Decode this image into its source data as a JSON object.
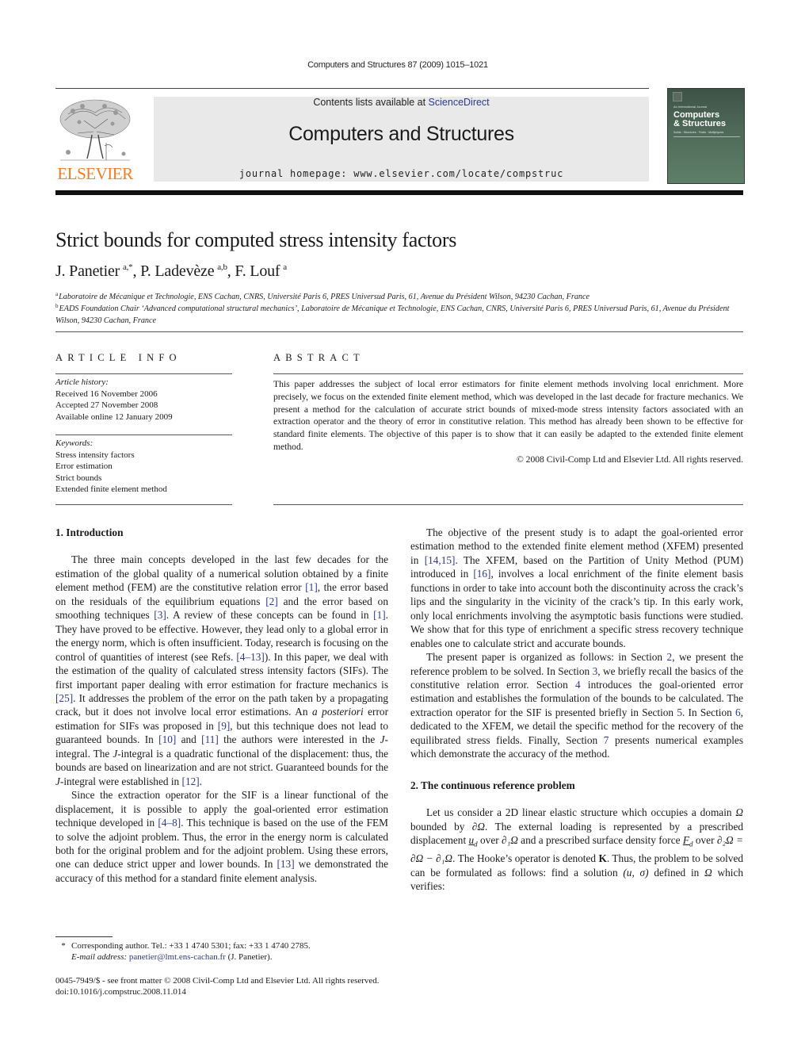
{
  "header": {
    "citation": "Computers and Structures 87 (2009) 1015–1021",
    "contents_prefix": "Contents lists available at ",
    "contents_link": "ScienceDirect",
    "journal_name": "Computers and Structures",
    "homepage": "journal homepage: www.elsevier.com/locate/compstruc",
    "publisher_logo_text": "ELSEVIER",
    "cover": {
      "tagline": "An International Journal",
      "title_line1": "Computers",
      "title_line2": "& Structures",
      "subtitle": "Solids · Structures · Fluids · Multiphysics"
    },
    "colors": {
      "elsevier_orange": "#f47b20",
      "link_blue": "#2b3a8c",
      "masthead_gray": "#e9e9e9",
      "cover_green": "#4e6a58"
    }
  },
  "article": {
    "title": "Strict bounds for computed stress intensity factors",
    "authors": [
      {
        "name": "J. Panetier",
        "sup": "a,*"
      },
      {
        "name": "P. Ladevèze",
        "sup": "a,b"
      },
      {
        "name": "F. Louf",
        "sup": "a"
      }
    ],
    "affiliations": [
      {
        "mark": "a",
        "text": "Laboratoire de Mécanique et Technologie, ENS Cachan, CNRS, Université Paris 6, PRES Universud Paris, 61, Avenue du Président Wilson, 94230 Cachan, France"
      },
      {
        "mark": "b",
        "text": "EADS Foundation Chair ‘Advanced computational structural mechanics’, Laboratoire de Mécanique et Technologie, ENS Cachan, CNRS, Université Paris 6, PRES Universud Paris, 61, Avenue du Président Wilson, 94230 Cachan, France"
      }
    ]
  },
  "article_info": {
    "heading": "ARTICLE INFO",
    "history_label": "Article history:",
    "history": [
      "Received 16 November 2006",
      "Accepted 27 November 2008",
      "Available online 12 January 2009"
    ],
    "keywords_label": "Keywords:",
    "keywords": [
      "Stress intensity factors",
      "Error estimation",
      "Strict bounds",
      "Extended finite element method"
    ]
  },
  "abstract": {
    "heading": "ABSTRACT",
    "text": "This paper addresses the subject of local error estimators for finite element methods involving local enrichment. More precisely, we focus on the extended finite element method, which was developed in the last decade for fracture mechanics. We present a method for the calculation of accurate strict bounds of mixed-mode stress intensity factors associated with an extraction operator and the theory of error in constitutive relation. This method has already been shown to be effective for standard finite elements. The objective of this paper is to show that it can easily be adapted to the extended finite element method.",
    "copyright": "© 2008 Civil-Comp Ltd and Elsevier Ltd. All rights reserved."
  },
  "body": {
    "sec1_heading": "1. Introduction",
    "p1": [
      "The three main concepts developed in the last few decades for the estimation of the global quality of a numerical solution obtained by a finite element method (FEM) are the constitutive relation error ",
      "[1]",
      ", the error based on the residuals of the equilibrium equations ",
      "[2]",
      " and the error based on smoothing techniques ",
      "[3]",
      ". A review of these concepts can be found in ",
      "[1]",
      ". They have proved to be effective. However, they lead only to a global error in the energy norm, which is often insufficient. Today, research is focusing on the control of quantities of interest (see Refs. ",
      "[4–13]",
      "). In this paper, we deal with the estimation of the quality of calculated stress intensity factors (SIFs). The first important paper dealing with error estimation for fracture mechanics is ",
      "[25]",
      ". It addresses the problem of the error on the path taken by a propagating crack, but it does not involve local error estimations. An ",
      "a posteriori",
      " error estimation for SIFs was proposed in ",
      "[9]",
      ", but this technique does not lead to guaranteed bounds. In ",
      "[10]",
      " and ",
      "[11]",
      " the authors were interested in the ",
      "J",
      "-integral. The ",
      "J",
      "-integral is a quadratic functional of the displacement: thus, the bounds are based on linearization and are not strict. Guaranteed bounds for the ",
      "J",
      "-integral were established in ",
      "[12]",
      "."
    ],
    "p2": [
      "Since the extraction operator for the SIF is a linear functional of the displacement, it is possible to apply the goal-oriented error estimation technique developed in ",
      "[4–8]",
      ". This technique is based on the use of the FEM to solve the adjoint problem. Thus, the error in the energy norm is calculated both for the original problem and for the adjoint problem. Using these errors, one can deduce strict upper and lower bounds. In ",
      "[13]",
      " we demonstrated the accuracy of this method for a standard finite element analysis."
    ],
    "p3": [
      "The objective of the present study is to adapt the goal-oriented error estimation method to the extended finite element method (XFEM) presented in ",
      "[14,15]",
      ". The XFEM, based on the Partition of Unity Method (PUM) introduced in ",
      "[16]",
      ", involves a local enrichment of the finite element basis functions in order to take into account both the discontinuity across the crack’s lips and the singularity in the vicinity of the crack’s tip. In this early work, only local enrichments involving the asymptotic basis functions were studied. We show that for this type of enrichment a specific stress recovery technique enables one to calculate strict and accurate bounds."
    ],
    "p4": [
      "The present paper is organized as follows: in Section ",
      "2",
      ", we present the reference problem to be solved. In Section ",
      "3",
      ", we briefly recall the basics of the constitutive relation error. Section ",
      "4",
      " introduces the goal-oriented error estimation and establishes the formulation of the bounds to be calculated. The extraction operator for the SIF is presented briefly in Section ",
      "5",
      ". In Section ",
      "6",
      ", dedicated to the XFEM, we detail the specific method for the recovery of the equilibrated stress fields. Finally, Section ",
      "7",
      " presents numerical examples which demonstrate the accuracy of the method."
    ],
    "sec2_heading": "2. The continuous reference problem",
    "p5": [
      "Let us consider a 2D linear elastic structure which occupies a domain ",
      "Ω",
      " bounded by ",
      "∂Ω",
      ". The external loading is represented by a prescribed displacement ",
      "u",
      "d",
      " over ",
      "∂₁Ω",
      " and a prescribed surface density force ",
      "F",
      "d",
      " over ",
      "∂₂Ω = ∂Ω − ∂₁Ω",
      ". The Hooke’s operator is denoted ",
      "K",
      ". Thus, the problem to be solved can be formulated as follows: find a solution ",
      "(u, σ)",
      " defined in ",
      "Ω",
      " which verifies:"
    ]
  },
  "footnotes": {
    "star": "*",
    "corresponding": "Corresponding author. Tel.: +33 1 4740 5301; fax: +33 1 4740 2785.",
    "email_label": "E-mail address:",
    "email": "panetier@lmt.ens-cachan.fr",
    "email_suffix": " (J. Panetier).",
    "front_matter": "0045-7949/$ - see front matter © 2008 Civil-Comp Ltd and Elsevier Ltd. All rights reserved.",
    "doi": "doi:10.1016/j.compstruc.2008.11.014"
  }
}
